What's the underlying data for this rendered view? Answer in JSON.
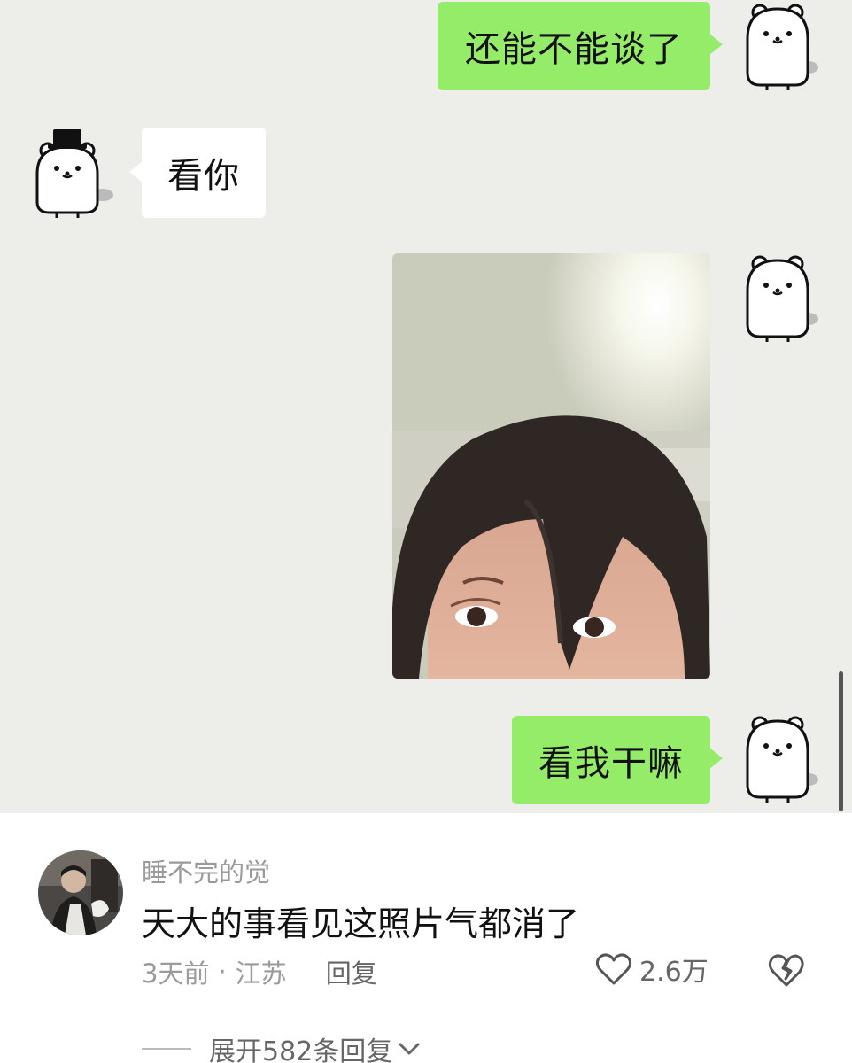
{
  "chat": {
    "messages": [
      {
        "side": "right",
        "type": "text",
        "text": "还能不能谈了"
      },
      {
        "side": "left",
        "type": "text",
        "text": "看你"
      },
      {
        "side": "right",
        "type": "image"
      },
      {
        "side": "right",
        "type": "text",
        "text": "看我干嘛"
      }
    ]
  },
  "comment": {
    "username": "睡不完的觉",
    "text": "天大的事看见这照片气都消了",
    "time": "3天前",
    "separator": "·",
    "location": "江苏",
    "reply_label": "回复",
    "likes": "2.6万",
    "expand_label": "展开582条回复"
  },
  "colors": {
    "chat_background": "#ededea",
    "sent_bubble": "#95ec69",
    "received_bubble": "#ffffff",
    "meta_text": "#9a9a9a"
  },
  "icons": {
    "like": "heart-outline-icon",
    "dislike": "broken-heart-icon",
    "expand": "chevron-down-icon"
  }
}
